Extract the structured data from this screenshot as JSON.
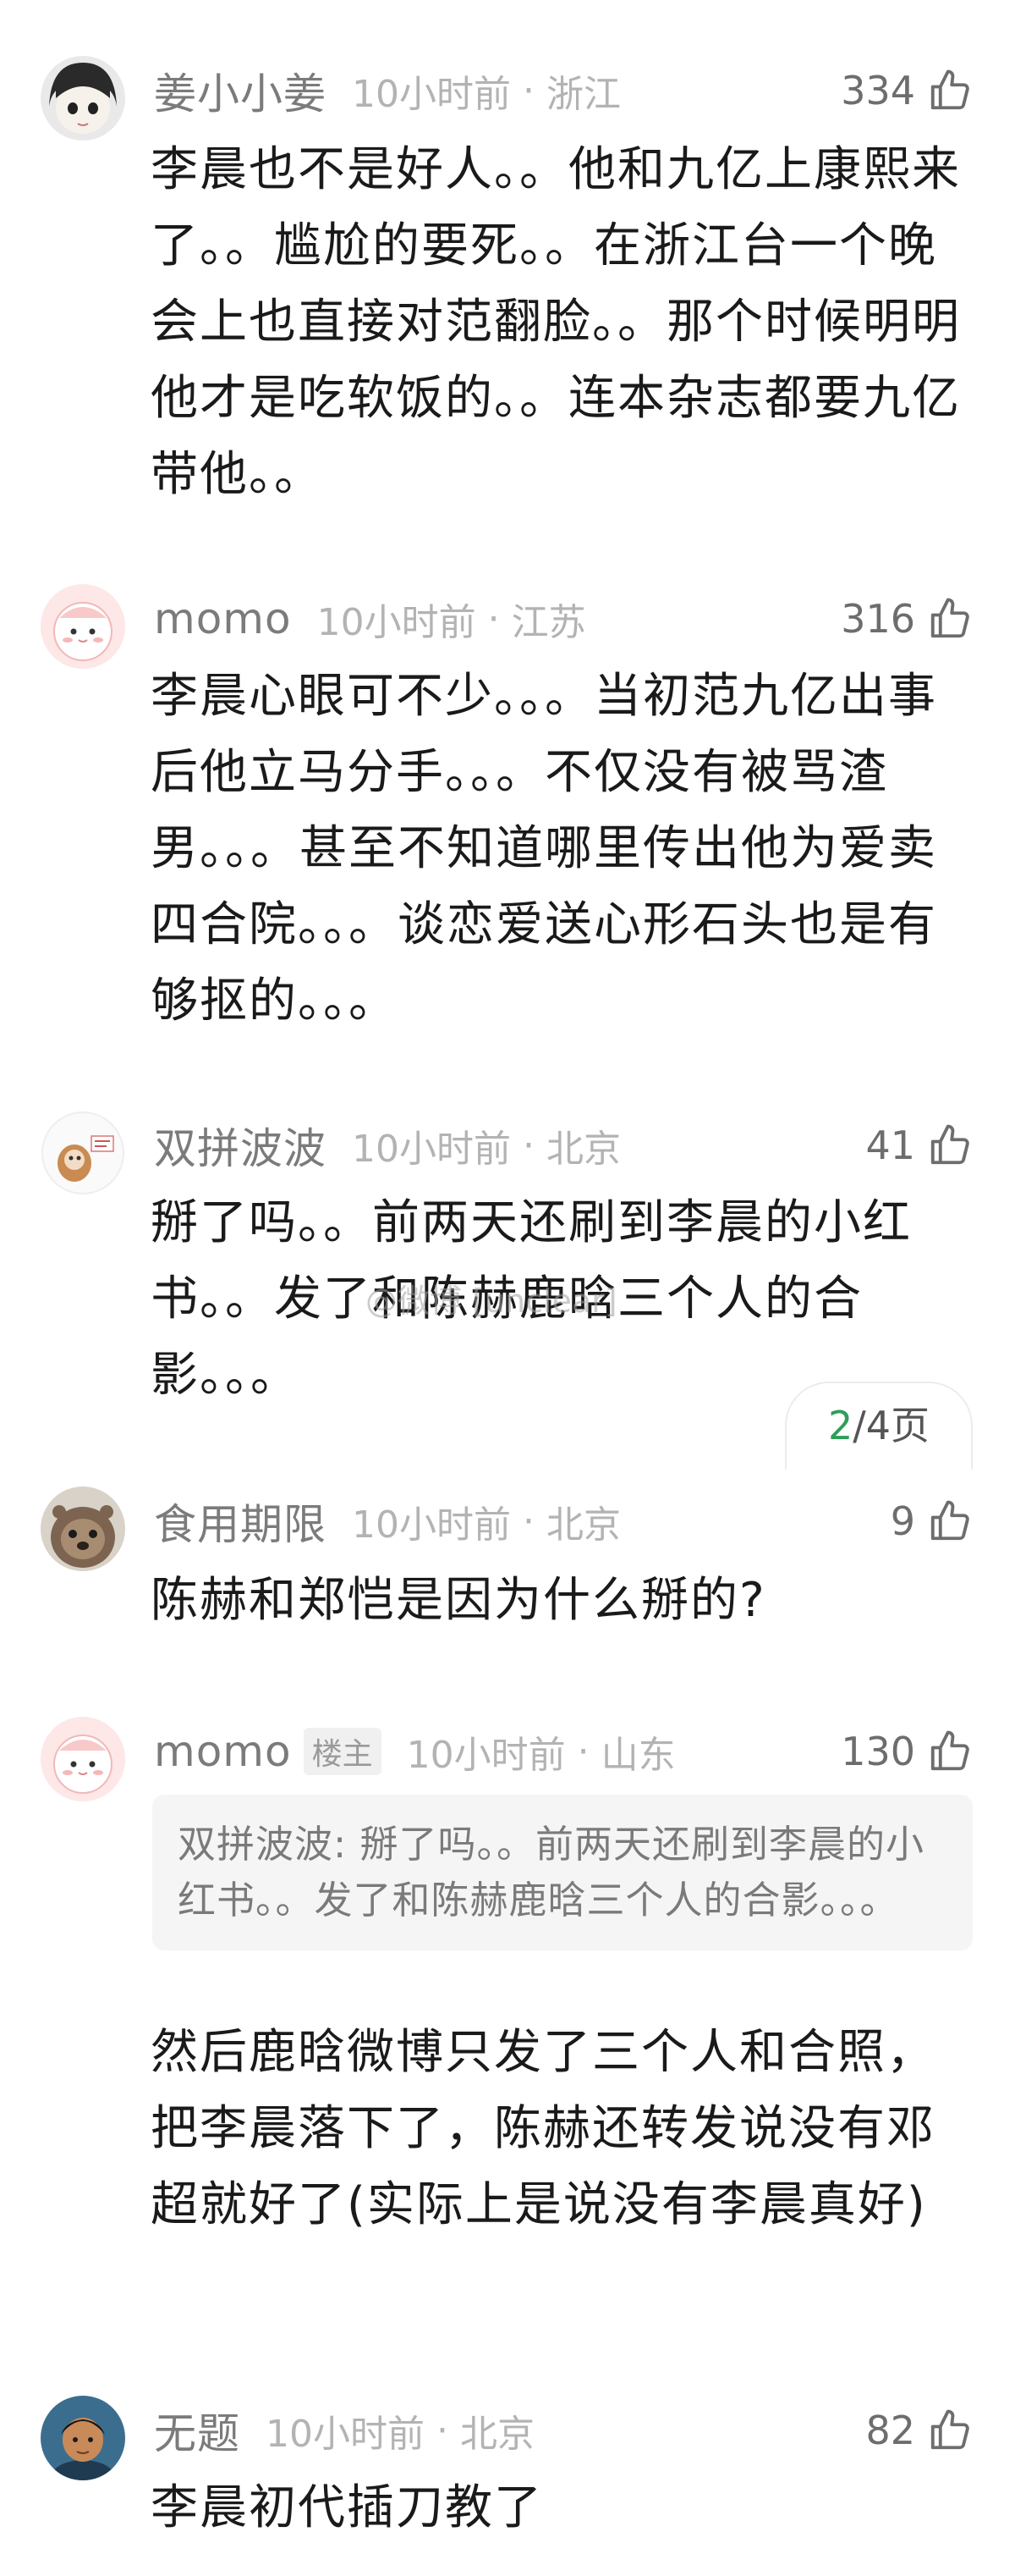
{
  "comments": [
    {
      "name": "姜小小姜",
      "time": "10小时前",
      "location": "浙江",
      "likes": "334",
      "text": "李晨也不是好人。。他和九亿上康熙来了。。尴尬的要死。。在浙江台一个晚会上也直接对范翻脸。。那个时候明明他才是吃软饭的。。连本杂志都要九亿带他。。"
    },
    {
      "name": "momo",
      "time": "10小时前",
      "location": "江苏",
      "likes": "316",
      "text": "李晨心眼可不少。。。当初范九亿出事后他立马分手。。。不仅没有被骂渣男。。。甚至不知道哪里传出他为爱卖四合院。。。谈恋爱送心形石头也是有够抠的。。。"
    },
    {
      "name": "双拼波波",
      "time": "10小时前",
      "location": "北京",
      "likes": "41",
      "text": "掰了吗。。前两天还刷到李晨的小红书。。发了和陈赫鹿晗三个人的合影。。。"
    },
    {
      "name": "食用期限",
      "time": "10小时前",
      "location": "北京",
      "likes": "9",
      "text": "陈赫和郑恺是因为什么掰的?"
    },
    {
      "name": "momo",
      "tag": "楼主",
      "time": "10小时前",
      "location": "山东",
      "likes": "130",
      "quote": "双拼波波: 掰了吗。。前两天还刷到李晨的小红书。。发了和陈赫鹿晗三个人的合影。。。",
      "text": "然后鹿晗微博只发了三个人和合照，把李晨落下了，陈赫还转发说没有邓超就好了(实际上是说没有李晨真好)"
    },
    {
      "name": "无题",
      "time": "10小时前",
      "location": "北京",
      "likes": "82",
      "text": "李晨初代插刀教了"
    }
  ],
  "pager": {
    "current": "2",
    "total": "/4页"
  },
  "watermark": "@微博 [unclear]",
  "icons": {
    "like": "thumbs-up-icon"
  },
  "colors": {
    "pager_current": "#2f9e57",
    "name": "#7b7b7b",
    "meta": "#b3b3b3"
  }
}
